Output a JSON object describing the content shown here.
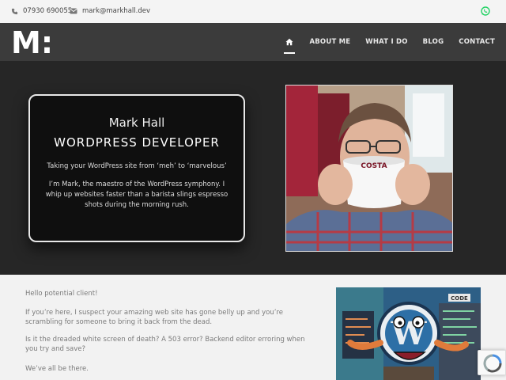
{
  "topbar": {
    "phone": "07930 690055",
    "email": "mark@markhall.dev",
    "phone_icon": "phone-icon",
    "email_icon": "envelope-icon",
    "whatsapp_icon": "whatsapp-icon"
  },
  "header": {
    "logo": "M:",
    "nav": [
      {
        "label": "ABOUT ME"
      },
      {
        "label": "WHAT I DO"
      },
      {
        "label": "BLOG"
      },
      {
        "label": "CONTACT"
      }
    ]
  },
  "hero": {
    "name": "Mark Hall",
    "title": "WORDPRESS DEVELOPER",
    "tagline": "Taking your WordPress site from ‘meh’ to ‘marvelous’",
    "body": "I’m Mark, the maestro of the WordPress symphony. I whip up websites faster than a barista slings espresso shots during the morning rush.",
    "mug_text": "COSTA"
  },
  "content": {
    "paragraphs": [
      "Hello potential client!",
      "If you’re here, I suspect your amazing web site has gone belly up and you’re scrambling for someone to bring it back from the dead.",
      "Is it the dreaded white screen of death? A 503 error? Backend editor erroring when you try and save?",
      "We’ve all be there."
    ],
    "art_sign": "CODE"
  },
  "colors": {
    "header_bg": "#3b3b3b",
    "hero_bg": "#262626",
    "whatsapp": "#25d366"
  }
}
